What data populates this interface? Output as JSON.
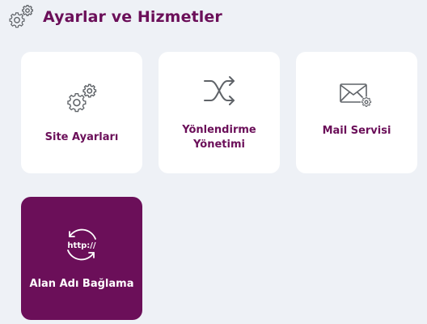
{
  "header": {
    "title": "Ayarlar ve Hizmetler",
    "icon": "gears-icon"
  },
  "cards": [
    {
      "label": "Site Ayarları",
      "icon": "gears-icon"
    },
    {
      "label_line1": "Yönlendirme",
      "label_line2": "Yönetimi",
      "icon": "shuffle-icon"
    },
    {
      "label": "Mail Servisi",
      "icon": "mail-gear-icon"
    },
    {
      "label": "Alan Adı Bağlama",
      "icon": "http-link-icon",
      "icon_text": "http://",
      "active": true
    }
  ],
  "colors": {
    "brand": "#6b0f59",
    "background": "#eef1f6",
    "card": "#ffffff",
    "icon_gray": "#5f6368"
  }
}
